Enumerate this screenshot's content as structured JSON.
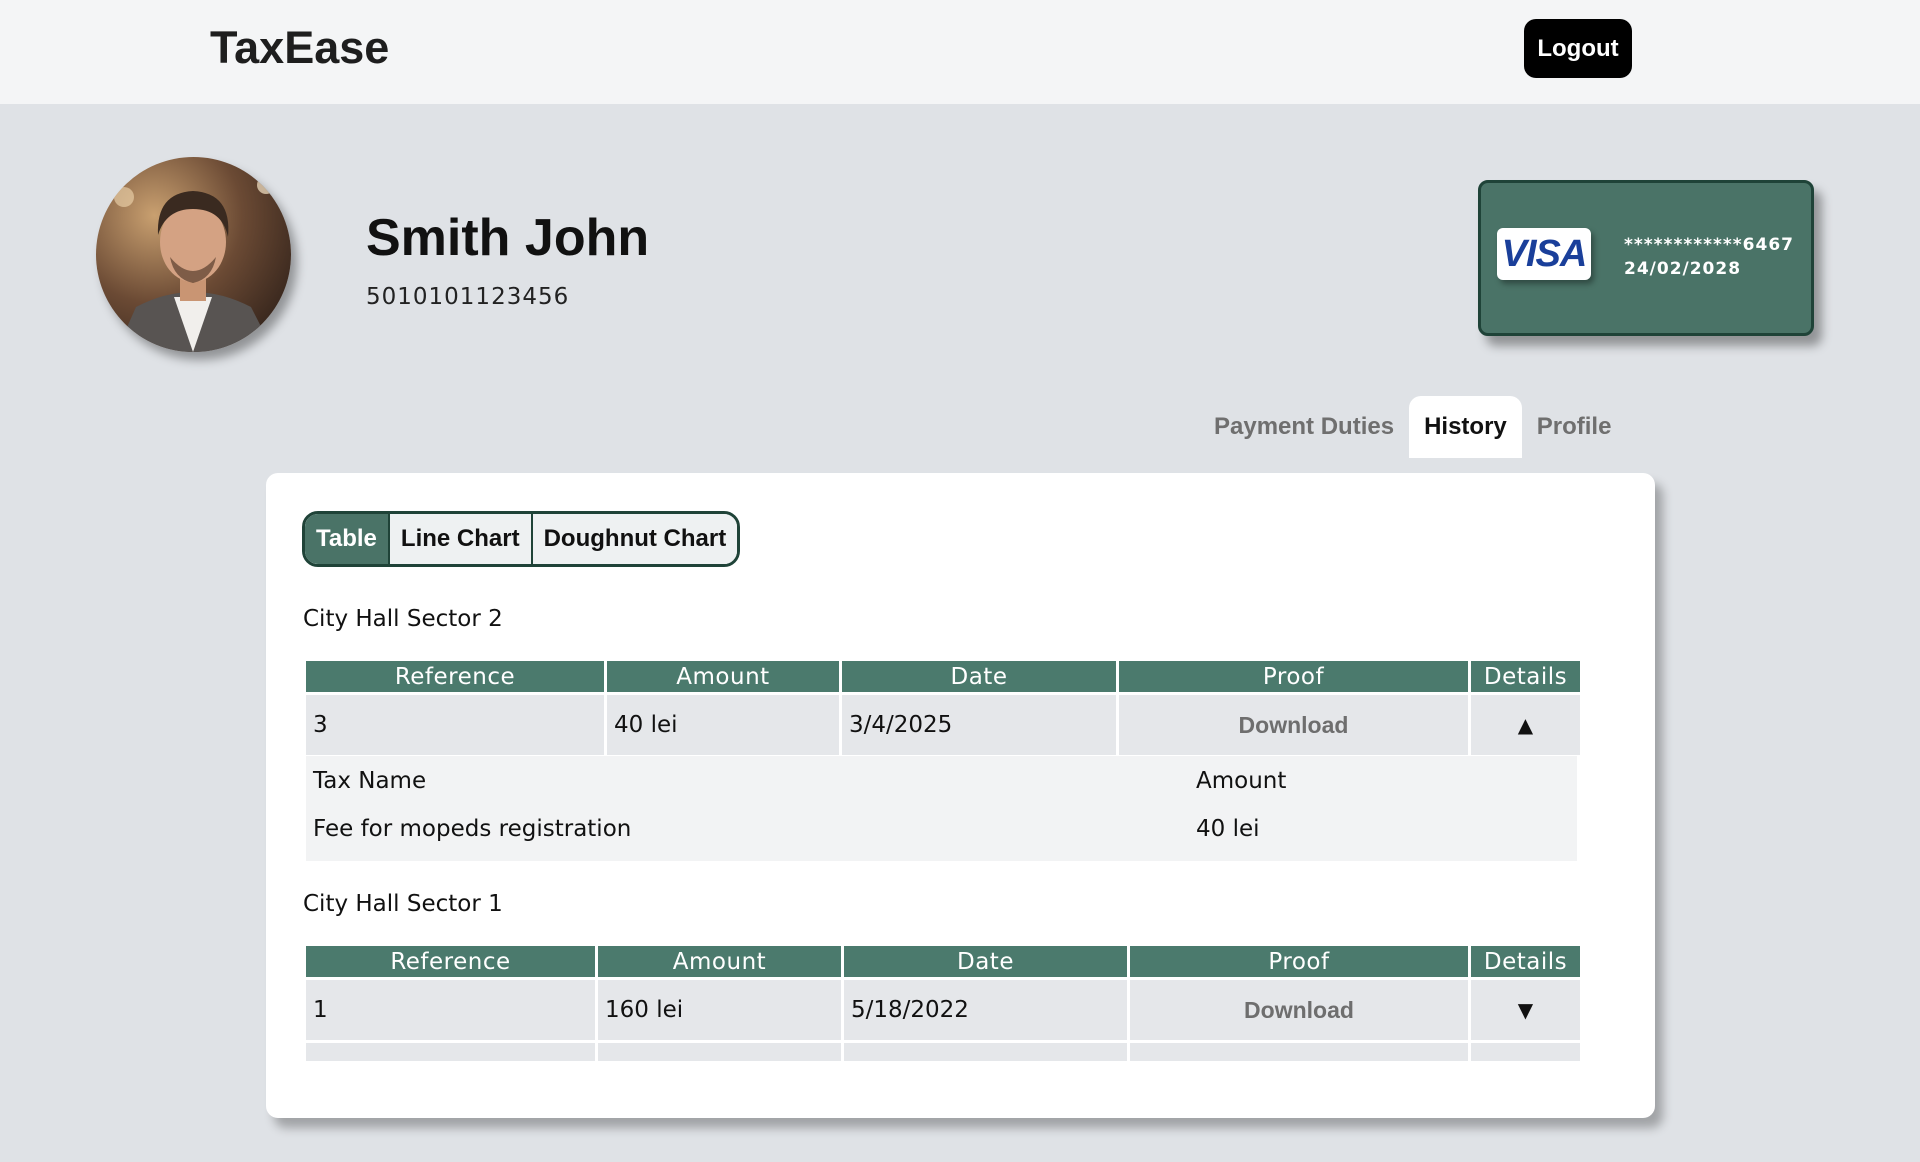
{
  "header": {
    "brand": "TaxEase",
    "logout_label": "Logout"
  },
  "user": {
    "name": "Smith John",
    "id": "5010101123456"
  },
  "card": {
    "brand": "VISA",
    "number": "************6467",
    "expiry": "24/02/2028"
  },
  "tabs": [
    {
      "label": "Payment Duties",
      "active": false
    },
    {
      "label": "History",
      "active": true
    },
    {
      "label": "Profile",
      "active": false
    }
  ],
  "view_toggle": [
    {
      "label": "Table",
      "active": true
    },
    {
      "label": "Line Chart",
      "active": false
    },
    {
      "label": "Doughnut Chart",
      "active": false
    }
  ],
  "columns": [
    "Reference",
    "Amount",
    "Date",
    "Proof",
    "Details"
  ],
  "groups": [
    {
      "title": "City Hall Sector 2",
      "rows": [
        {
          "reference": "3",
          "amount": "40 lei",
          "date": "3/4/2025",
          "proof": "Download",
          "toggle": "▲",
          "expanded": true
        }
      ],
      "details": {
        "header_tax": "Tax Name",
        "header_amount": "Amount",
        "tax_name": "Fee for mopeds registration",
        "amount": "40 lei"
      }
    },
    {
      "title": "City Hall Sector 1",
      "rows": [
        {
          "reference": "1",
          "amount": "160 lei",
          "date": "5/18/2022",
          "proof": "Download",
          "toggle": "▼",
          "expanded": false
        }
      ]
    }
  ],
  "colors": {
    "accent": "#4a7367",
    "header_row": "#4b7a6d",
    "page_bg": "#dfe2e6"
  }
}
